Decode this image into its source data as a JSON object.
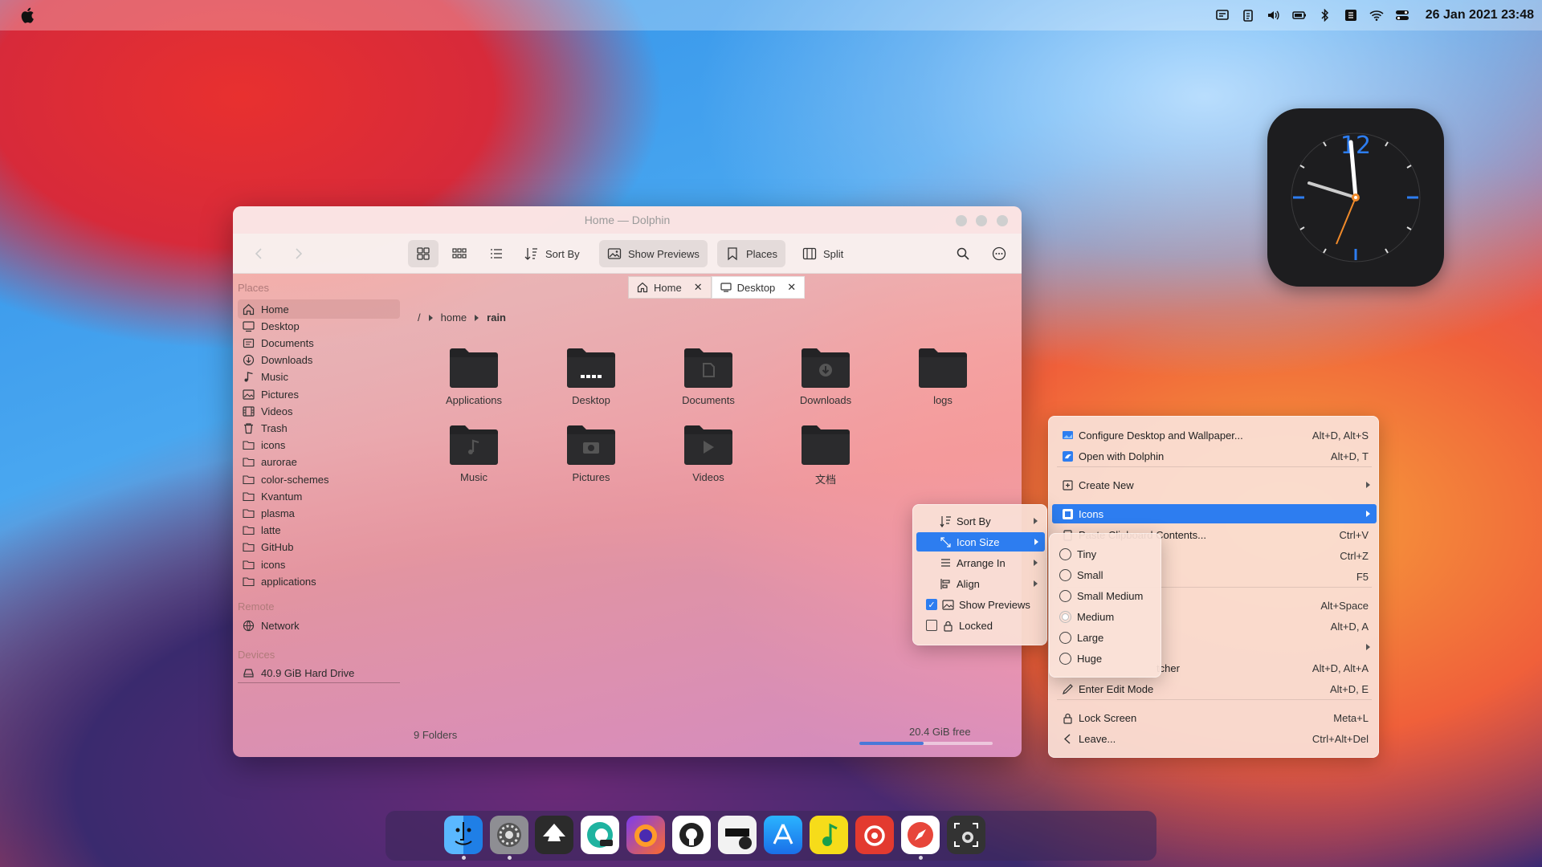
{
  "topbar": {
    "datetime": "26 Jan 2021 23:48",
    "tray_icons": [
      "message-icon",
      "clipboard-icon",
      "volume-icon",
      "battery-icon",
      "bluetooth-icon",
      "keyboard-icon",
      "wifi-icon",
      "control-center-icon"
    ]
  },
  "window": {
    "title": "Home — Dolphin",
    "toolbar": {
      "sort_by": "Sort By",
      "show_previews": "Show Previews",
      "places": "Places",
      "split": "Split"
    },
    "tabs": [
      {
        "label": "Home"
      },
      {
        "label": "Desktop"
      }
    ],
    "sidebar": {
      "places_title": "Places",
      "places": [
        {
          "label": "Home",
          "icon": "home-icon"
        },
        {
          "label": "Desktop",
          "icon": "desktop-icon"
        },
        {
          "label": "Documents",
          "icon": "document-icon"
        },
        {
          "label": "Downloads",
          "icon": "download-icon"
        },
        {
          "label": "Music",
          "icon": "music-icon"
        },
        {
          "label": "Pictures",
          "icon": "picture-icon"
        },
        {
          "label": "Videos",
          "icon": "video-icon"
        },
        {
          "label": "Trash",
          "icon": "trash-icon"
        },
        {
          "label": "icons",
          "icon": "folder-icon"
        },
        {
          "label": "aurorae",
          "icon": "folder-icon"
        },
        {
          "label": "color-schemes",
          "icon": "folder-icon"
        },
        {
          "label": "Kvantum",
          "icon": "folder-icon"
        },
        {
          "label": "plasma",
          "icon": "folder-icon"
        },
        {
          "label": "latte",
          "icon": "folder-icon"
        },
        {
          "label": "GitHub",
          "icon": "folder-icon"
        },
        {
          "label": "icons",
          "icon": "folder-icon"
        },
        {
          "label": "applications",
          "icon": "folder-icon"
        }
      ],
      "remote_title": "Remote",
      "network": "Network",
      "devices_title": "Devices",
      "drive": "40.9 GiB Hard Drive"
    },
    "breadcrumb": {
      "root": "/",
      "home": "home",
      "current": "rain"
    },
    "folders": [
      {
        "label": "Applications",
        "emblem": ""
      },
      {
        "label": "Desktop",
        "emblem": "desktop"
      },
      {
        "label": "Documents",
        "emblem": "document"
      },
      {
        "label": "Downloads",
        "emblem": "download"
      },
      {
        "label": "logs",
        "emblem": ""
      },
      {
        "label": "Music",
        "emblem": "music"
      },
      {
        "label": "Pictures",
        "emblem": "camera"
      },
      {
        "label": "Videos",
        "emblem": "play"
      },
      {
        "label": "文档",
        "emblem": ""
      }
    ],
    "status": "9 Folders",
    "free_space": "20.4 GiB free",
    "free_fraction": 0.48
  },
  "desktop_menu": {
    "items": [
      {
        "label": "Configure Desktop and Wallpaper...",
        "shortcut": "Alt+D, Alt+S"
      },
      {
        "label": "Open with Dolphin",
        "shortcut": "Alt+D, T"
      },
      {
        "label": "Create New",
        "shortcut": ""
      },
      {
        "label": "Icons",
        "shortcut": ""
      },
      {
        "label": "Paste Clipboard Contents...",
        "shortcut": "Ctrl+V"
      },
      {
        "label": "",
        "shortcut": "Ctrl+Z"
      },
      {
        "label": "",
        "shortcut": "F5"
      },
      {
        "label": "",
        "shortcut": "Alt+Space"
      },
      {
        "label": "",
        "shortcut": "Alt+D, A"
      },
      {
        "label": "tcher",
        "shortcut": "Alt+D, Alt+A"
      },
      {
        "label": "Enter Edit Mode",
        "shortcut": "Alt+D, E"
      },
      {
        "label": "Lock Screen",
        "shortcut": "Meta+L"
      },
      {
        "label": "Leave...",
        "shortcut": "Ctrl+Alt+Del"
      }
    ]
  },
  "icons_menu": {
    "sort_by": "Sort By",
    "icon_size": "Icon Size",
    "arrange_in": "Arrange In",
    "align": "Align",
    "show_previews": "Show Previews",
    "locked": "Locked"
  },
  "size_menu": {
    "options": [
      "Tiny",
      "Small",
      "Small Medium",
      "Medium",
      "Large",
      "Huge"
    ],
    "selected": "Medium"
  },
  "clock": {
    "twelve": "12"
  },
  "dock": {
    "apps": [
      "finder-icon",
      "system-settings-icon",
      "inkscape-icon",
      "edge-dev-icon",
      "firefox-icon",
      "github-icon",
      "kvantum-icon",
      "app-store-icon",
      "music-player-icon",
      "netease-music-icon",
      "safari-icon",
      "screenshot-icon"
    ]
  },
  "colors": {
    "accent": "#2d7df0",
    "folder": "#2b2b2d"
  }
}
